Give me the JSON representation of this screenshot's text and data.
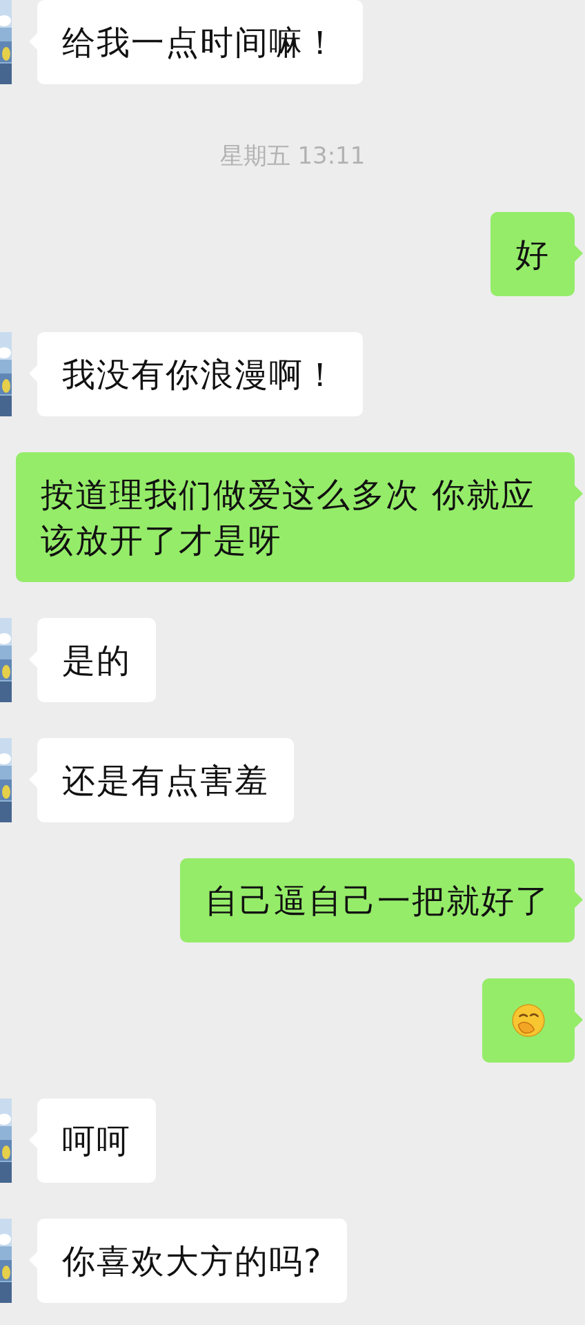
{
  "messages": [
    {
      "kind": "text",
      "outgoing": false,
      "text": "给我一点时间嘛！"
    },
    {
      "kind": "time",
      "text": "星期五 13:11"
    },
    {
      "kind": "text",
      "outgoing": true,
      "text": "好"
    },
    {
      "kind": "text",
      "outgoing": false,
      "text": "我没有你浪漫啊！"
    },
    {
      "kind": "text",
      "outgoing": true,
      "text": "按道理我们做爱这么多次 你就应该放开了才是呀"
    },
    {
      "kind": "text",
      "outgoing": false,
      "text": "是的"
    },
    {
      "kind": "text",
      "outgoing": false,
      "text": "还是有点害羞"
    },
    {
      "kind": "text",
      "outgoing": true,
      "text": "自己逼自己一把就好了"
    },
    {
      "kind": "emoji",
      "outgoing": true
    },
    {
      "kind": "text",
      "outgoing": false,
      "text": "呵呵"
    },
    {
      "kind": "text",
      "outgoing": false,
      "text": "你喜欢大方的吗?"
    }
  ]
}
